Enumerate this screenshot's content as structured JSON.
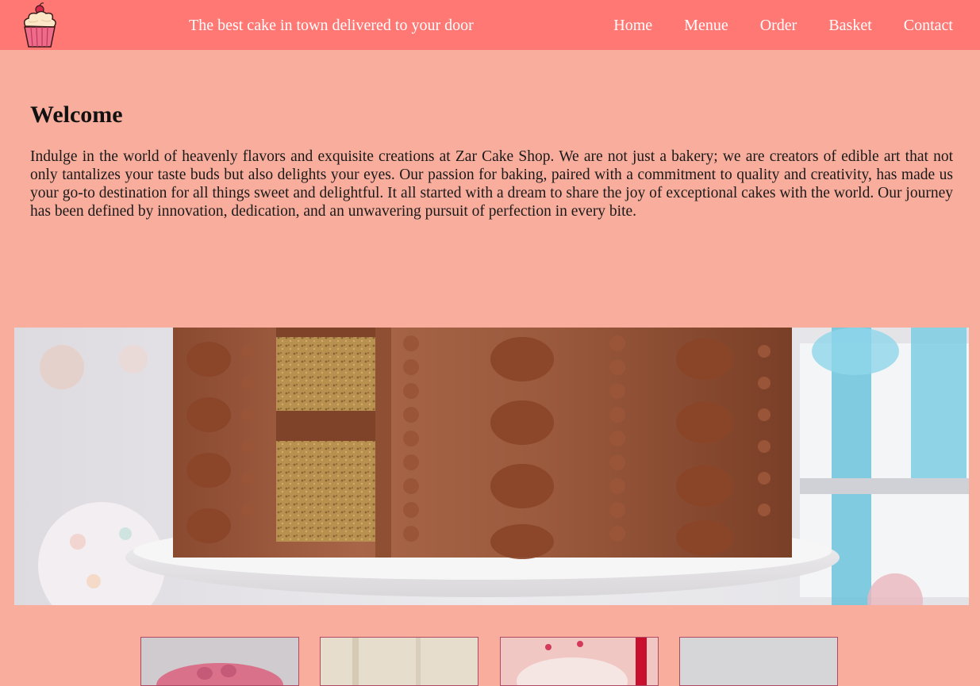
{
  "header": {
    "tagline": "The best cake in town delivered to your door",
    "logo_icon": "cupcake-icon",
    "nav": [
      {
        "label": "Home"
      },
      {
        "label": "Menue"
      },
      {
        "label": "Order"
      },
      {
        "label": "Basket"
      },
      {
        "label": "Contact"
      }
    ]
  },
  "main": {
    "title": "Welcome",
    "intro": "Indulge in the world of heavenly flavors and exquisite creations at Zar Cake Shop. We are not just a bakery; we are creators of edible art that not only tantalizes your taste buds but also delights your eyes. Our passion for baking, paired with a commitment to quality and creativity, has made us your go-to destination for all things sweet and delightful. It all started with a dream to share the joy of exceptional cakes with the world. Our journey has been defined by innovation, dedication, and an unwavering pursuit of perfection in every bite."
  },
  "colors": {
    "header_bg": "#ff7874",
    "page_bg": "#f9ae9d",
    "nav_text": "#ffffff"
  }
}
